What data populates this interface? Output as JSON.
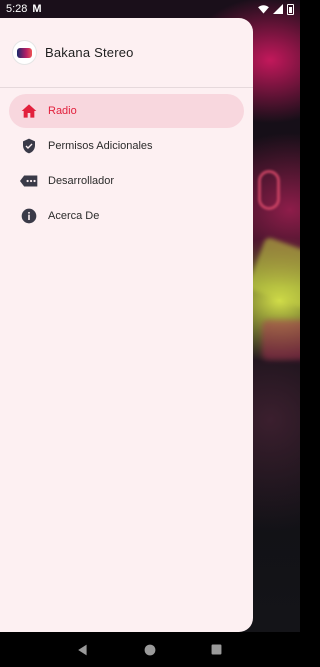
{
  "status_bar": {
    "time": "5:28",
    "notification_icon": "M"
  },
  "drawer": {
    "app_title": "Bakana Stereo",
    "items": [
      {
        "label": "Radio",
        "icon": "home-icon",
        "active": true
      },
      {
        "label": "Permisos Adicionales",
        "icon": "shield-check-icon",
        "active": false
      },
      {
        "label": "Desarrollador",
        "icon": "developer-tag-icon",
        "active": false
      },
      {
        "label": "Acerca De",
        "icon": "info-icon",
        "active": false
      }
    ]
  },
  "colors": {
    "accent": "#e2213d",
    "active_bg": "#f8d7de",
    "drawer_bg": "#fdf0f2"
  }
}
